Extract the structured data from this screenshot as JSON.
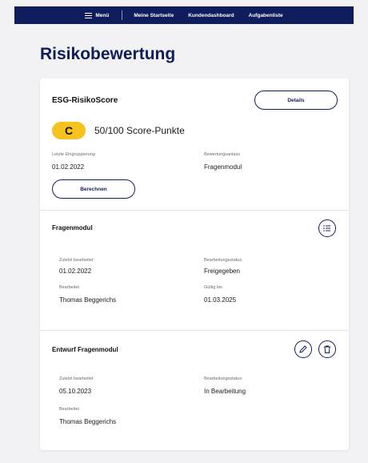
{
  "nav": {
    "menu_label": "Menü",
    "links": [
      "Meine Startseite",
      "Kundendashboard",
      "Aufgabenliste"
    ]
  },
  "page": {
    "title": "Risikobewertung"
  },
  "score_card": {
    "title": "ESG-RisikoScore",
    "details_label": "Details",
    "grade": "C",
    "score_text": "50/100 Score-Punkte",
    "last_grouping_label": "Letzte Eingruppierung",
    "last_grouping_value": "01.02.2022",
    "occasion_label": "Bewertungsanlass",
    "occasion_value": "Fragenmodul",
    "calculate_label": "Berechnen"
  },
  "questionnaire": {
    "title": "Fragenmodul",
    "last_edited_label": "Zuletzt bearbeitet",
    "last_edited_value": "01.02.2022",
    "status_label": "Bearbeitungsstatus",
    "status_value": "Freigegeben",
    "editor_label": "Bearbeiter",
    "editor_value": "Thomas Beggerichs",
    "valid_until_label": "Gültig bis",
    "valid_until_value": "01.03.2025"
  },
  "draft": {
    "title": "Entwurf Fragenmodul",
    "last_edited_label": "Zuletzt bearbeitet",
    "last_edited_value": "05.10.2023",
    "status_label": "Bearbeitungsstatus",
    "status_value": "In Bearbeitung",
    "editor_label": "Bearbeiter",
    "editor_value": "Thomas Beggerichs"
  },
  "colors": {
    "brand_navy": "#0f1d5c",
    "grade_yellow": "#f5c21f",
    "background": "#f2f2f4"
  },
  "icons": {
    "menu": "hamburger-icon",
    "list": "list-icon",
    "edit": "pencil-icon",
    "delete": "trash-icon"
  }
}
